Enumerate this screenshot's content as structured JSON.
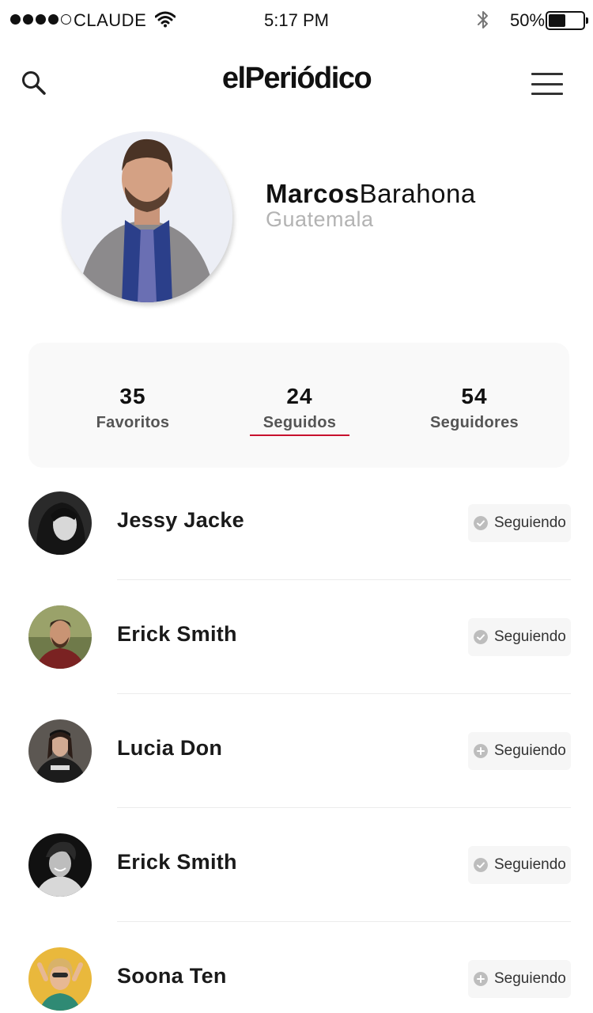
{
  "status_bar": {
    "carrier": "CLAUDE",
    "time": "5:17 PM",
    "battery_percent": "50%",
    "battery_level": 0.5,
    "signal_strength": 4,
    "signal_max": 5
  },
  "header": {
    "logo": "elPeriódico",
    "search_icon": "search-icon",
    "menu_icon": "hamburger-menu-icon"
  },
  "profile": {
    "first_name": "Marcos",
    "last_name": "Barahona",
    "location": "Guatemala"
  },
  "stats": [
    {
      "value": "35",
      "label": "Favoritos"
    },
    {
      "value": "24",
      "label": "Seguidos"
    },
    {
      "value": "54",
      "label": "Seguidores"
    }
  ],
  "following": [
    {
      "name": "Jessy Jacke",
      "button_label": "Seguiendo",
      "icon": "check-icon"
    },
    {
      "name": "Erick Smith",
      "button_label": "Seguiendo",
      "icon": "check-icon"
    },
    {
      "name": "Lucia Don",
      "button_label": "Seguiendo",
      "icon": "plus-icon"
    },
    {
      "name": "Erick Smith",
      "button_label": "Seguiendo",
      "icon": "check-icon"
    },
    {
      "name": "Soona Ten",
      "button_label": "Seguiendo",
      "icon": "plus-icon"
    }
  ],
  "colors": {
    "accent": "#c8102e",
    "text_muted": "#b3b3b3",
    "card_bg": "#f9f9f9"
  }
}
